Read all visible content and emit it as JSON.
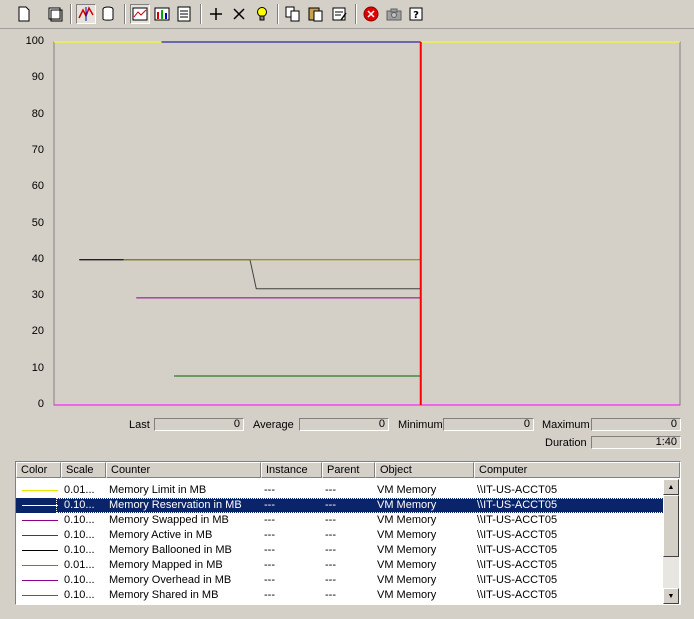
{
  "toolbar": {
    "buttons": [
      {
        "name": "new-counter-set-button",
        "icon": "new-page-icon"
      },
      {
        "name": "clear-display-button",
        "icon": "clear-icon"
      },
      {
        "name": "view-current-activity-button",
        "icon": "current-activity-icon",
        "pressed": true
      },
      {
        "name": "view-log-data-button",
        "icon": "database-icon"
      },
      {
        "name": "view-graph-button",
        "icon": "graph-icon",
        "pressed": true
      },
      {
        "name": "view-histogram-button",
        "icon": "histogram-icon"
      },
      {
        "name": "view-report-button",
        "icon": "report-icon"
      },
      {
        "name": "add-counter-button",
        "icon": "plus-icon"
      },
      {
        "name": "delete-counter-button",
        "icon": "x-icon"
      },
      {
        "name": "highlight-button",
        "icon": "lightbulb-icon"
      },
      {
        "name": "copy-properties-button",
        "icon": "copy-icon"
      },
      {
        "name": "paste-counter-list-button",
        "icon": "paste-icon"
      },
      {
        "name": "properties-button",
        "icon": "properties-icon"
      },
      {
        "name": "freeze-display-button",
        "icon": "stop-icon"
      },
      {
        "name": "update-data-button",
        "icon": "camera-icon"
      },
      {
        "name": "help-button",
        "icon": "help-icon"
      }
    ]
  },
  "chart_data": {
    "type": "line",
    "y_ticks": [
      "100",
      "90",
      "80",
      "70",
      "60",
      "50",
      "40",
      "30",
      "20",
      "10",
      "0"
    ],
    "ylim": [
      0,
      100
    ],
    "x_points": 100,
    "time_bar_position": 58,
    "series": [
      {
        "counter": "Memory Limit in MB",
        "color": "#ffff00",
        "points": [
          [
            0,
            100
          ],
          [
            58,
            100
          ],
          [
            58,
            100
          ],
          [
            99,
            100
          ]
        ]
      },
      {
        "counter": "Memory Reservation in MB",
        "color": "#00008b",
        "points": [
          [
            17,
            100
          ],
          [
            58,
            100
          ]
        ]
      },
      {
        "counter": "Memory Swapped in MB",
        "color": "#8b008b",
        "points": [
          [
            13,
            29.5
          ],
          [
            58,
            29.5
          ]
        ]
      },
      {
        "counter": "Memory Active in MB",
        "color": "#404040",
        "points": [
          [
            4,
            40
          ],
          [
            31,
            40
          ],
          [
            32,
            32
          ],
          [
            58,
            32
          ]
        ]
      },
      {
        "counter": "Memory Ballooned in MB",
        "color": "#000000",
        "points": [
          [
            4,
            40
          ],
          [
            11,
            40
          ]
        ]
      },
      {
        "counter": "Memory Mapped in MB",
        "color": "#808000",
        "points": [
          [
            11,
            40
          ],
          [
            58,
            40
          ]
        ]
      },
      {
        "counter": "Memory Overhead in MB",
        "color": "#ff00ff",
        "points": [
          [
            0,
            0
          ],
          [
            99,
            0
          ]
        ]
      },
      {
        "counter": "Memory Shared in MB",
        "color": "#006400",
        "points": [
          [
            19,
            8
          ],
          [
            58,
            8
          ]
        ]
      }
    ]
  },
  "values": {
    "last_label": "Last",
    "last": "0",
    "average_label": "Average",
    "average": "0",
    "minimum_label": "Minimum",
    "minimum": "0",
    "maximum_label": "Maximum",
    "maximum": "0",
    "duration_label": "Duration",
    "duration": "1:40"
  },
  "legend": {
    "headers": {
      "color": "Color",
      "scale": "Scale",
      "counter": "Counter",
      "instance": "Instance",
      "parent": "Parent",
      "object": "Object",
      "computer": "Computer"
    },
    "rows": [
      {
        "color": "#e6e600",
        "scale": "0.01...",
        "counter": "Memory Limit in MB",
        "instance": "---",
        "parent": "---",
        "object": "VM Memory",
        "computer": "\\\\IT-US-ACCT05"
      },
      {
        "color": "#ffffff",
        "scale": "0.10...",
        "counter": "Memory Reservation in MB",
        "instance": "---",
        "parent": "---",
        "object": "VM Memory",
        "computer": "\\\\IT-US-ACCT05",
        "selected": true
      },
      {
        "color": "#8b008b",
        "scale": "0.10...",
        "counter": "Memory Swapped in MB",
        "instance": "---",
        "parent": "---",
        "object": "VM Memory",
        "computer": "\\\\IT-US-ACCT05"
      },
      {
        "color": "#404040",
        "scale": "0.10...",
        "counter": "Memory Active in MB",
        "instance": "---",
        "parent": "---",
        "object": "VM Memory",
        "computer": "\\\\IT-US-ACCT05"
      },
      {
        "color": "#000000",
        "scale": "0.10...",
        "counter": "Memory Ballooned in MB",
        "instance": "---",
        "parent": "---",
        "object": "VM Memory",
        "computer": "\\\\IT-US-ACCT05"
      },
      {
        "color": "#808000",
        "scale": "0.01...",
        "counter": "Memory Mapped in MB",
        "instance": "---",
        "parent": "---",
        "object": "VM Memory",
        "computer": "\\\\IT-US-ACCT05"
      },
      {
        "color": "#8b008b",
        "scale": "0.10...",
        "counter": "Memory Overhead in MB",
        "instance": "---",
        "parent": "---",
        "object": "VM Memory",
        "computer": "\\\\IT-US-ACCT05"
      },
      {
        "color": "#008080",
        "scale": "0.10...",
        "counter": "Memory Shared in MB",
        "instance": "---",
        "parent": "---",
        "object": "VM Memory",
        "computer": "\\\\IT-US-ACCT05"
      }
    ]
  }
}
